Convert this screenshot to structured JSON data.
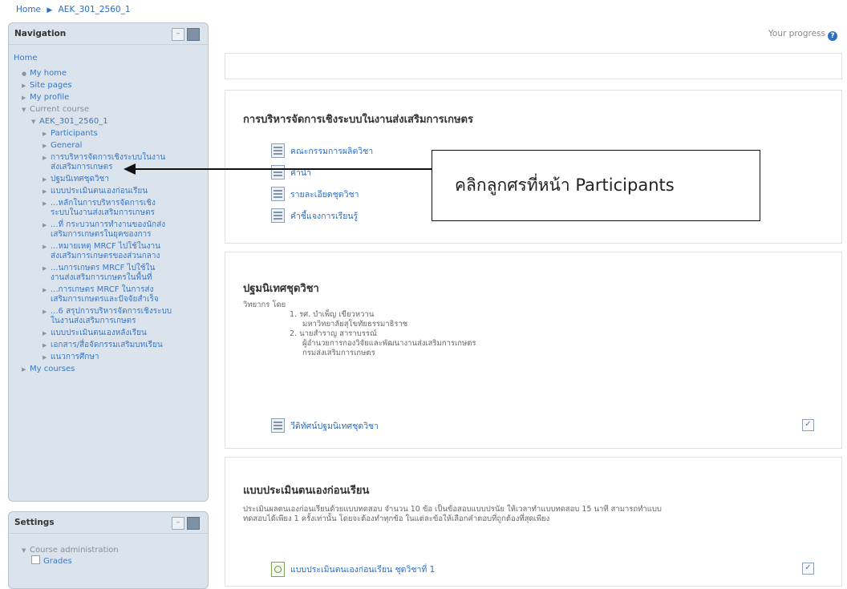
{
  "breadcrumb": {
    "home": "Home",
    "separator": "▶",
    "course": "AEK_301_2560_1"
  },
  "navigation": {
    "title": "Navigation",
    "home": "Home",
    "items": [
      {
        "label": "My home",
        "level": 1,
        "arrow": "●"
      },
      {
        "label": "Site pages",
        "level": 1,
        "arrow": "▶"
      },
      {
        "label": "My profile",
        "level": 1,
        "arrow": "▶"
      },
      {
        "label": "Current course",
        "level": 1,
        "arrow": "▼"
      },
      {
        "label": "AEK_301_2560_1",
        "level": 2,
        "arrow": "▼"
      },
      {
        "label": "Participants",
        "level": 3,
        "arrow": "▶"
      },
      {
        "label": "General",
        "level": 3,
        "arrow": "▶"
      },
      {
        "label": "การบริหารจัดการเชิงระบบในงาน",
        "label2": "ส่งเสริมการเกษตร",
        "level": 3,
        "arrow": "▶"
      },
      {
        "label": "ปฐมนิเทศชุดวิชา",
        "level": 3,
        "arrow": "▶"
      },
      {
        "label": "แบบประเมินตนเองก่อนเรียน",
        "level": 3,
        "arrow": "▶"
      },
      {
        "label": "...หลักในการบริหารจัดการเชิง",
        "label2": "ระบบในงานส่งเสริมการเกษตร",
        "level": 3,
        "arrow": "▶"
      },
      {
        "label": "...ที่ กระบวนการทำงานของนักส่ง",
        "label2": "เสริมการเกษตรในยุคของการ",
        "level": 3,
        "arrow": "▶"
      },
      {
        "label": "...หมายเหตุ MRCF ไปใช้ในงาน",
        "label2": "ส่งเสริมการเกษตรของส่วนกลาง",
        "level": 3,
        "arrow": "▶"
      },
      {
        "label": "...นการเกษตร MRCF ไปใช้ใน",
        "label2": "งานส่งเสริมการเกษตรในพื้นที่",
        "level": 3,
        "arrow": "▶"
      },
      {
        "label": "...การเกษตร MRCF ในการส่ง",
        "label2": "เสริมการเกษตรและปัจจัยสำเร็จ",
        "level": 3,
        "arrow": "▶"
      },
      {
        "label": "...6 สรุปการบริหารจัดการเชิงระบบ",
        "label2": "ในงานส่งเสริมการเกษตร",
        "level": 3,
        "arrow": "▶"
      },
      {
        "label": "แบบประเมินตนเองหลังเรียน",
        "level": 3,
        "arrow": "▶"
      },
      {
        "label": "เอกสาร/สื่อจัดกรรมเสริมบทเรียน",
        "level": 3,
        "arrow": "▶"
      },
      {
        "label": "แนวการศึกษา",
        "level": 3,
        "arrow": "▶"
      },
      {
        "label": "My courses",
        "level": 1,
        "arrow": "▶"
      }
    ]
  },
  "settings": {
    "title": "Settings",
    "items": [
      {
        "label": "Course administration",
        "arrow": "▼"
      },
      {
        "label": "Grades"
      }
    ]
  },
  "main": {
    "progress_label": "Your progress",
    "progress_icon": "?",
    "section1": {
      "title": "การบริหารจัดการเชิงระบบในงานส่งเสริมการเกษตร",
      "activities": [
        "คณะกรรมการผลิตวิชา",
        "คำนำ",
        "รายละเอียดชุดวิชา",
        "คำชี้แจงการเรียนรู้"
      ]
    },
    "section2": {
      "title": "ปฐมนิเทศชุดวิชา",
      "lines": [
        "วิทยากร โดย",
        "1. รศ. บำเพ็ญ เขียวหวาน",
        "มหาวิทยาลัยสุโขทัยธรรมาธิราช",
        "2. นายสำราญ สาราบรรณ์",
        "ผู้อำนวยการกองวิจัยและพัฒนางานส่งเสริมการเกษตร",
        "กรมส่งเสริมการเกษตร"
      ],
      "activity": "วีดิทัศน์ปฐมนิเทศชุดวิชา"
    },
    "section3": {
      "title": "แบบประเมินตนเองก่อนเรียน",
      "desc_line1": "ประเมินผลตนเองก่อนเรียนด้วยแบบทดสอบ จำนวน 10 ข้อ เป็นข้อสอบแบบปรนัย ให้เวลาทำแบบทดสอบ 15 นาที สามารถทำแบบ",
      "desc_line2": "ทดสอบได้เพียง 1 ครั้งเท่านั้น โดยจะต้องทำทุกข้อ ในแต่ละข้อให้เลือกคำตอบที่ถูกต้องที่สุดเพียง",
      "activity": "แบบประเมินตนเองก่อนเรียน ชุดวิชาที่ 1"
    }
  },
  "callout": {
    "text": "คลิกลูกศรที่หน้า Participants"
  }
}
